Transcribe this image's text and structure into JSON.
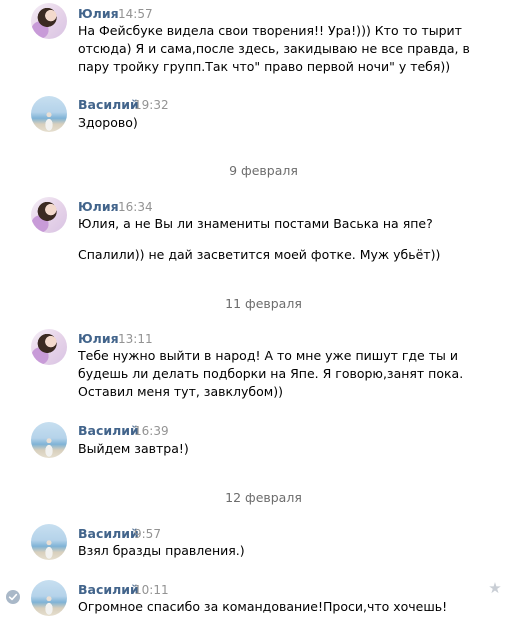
{
  "messages": [
    {
      "author": "Юлия",
      "time": "14:57",
      "lines": [
        "На Фейсбуке видела свои творения!! Ура!))) Кто то тырит",
        "отсюда) Я и сама,после здесь, закидываю не все правда, в",
        "пару тройку групп.Так что\" право первой ночи\" у тебя))"
      ]
    },
    {
      "author": "Василий",
      "time": "19:32",
      "lines": [
        "Здорово)"
      ]
    },
    {
      "date": "9 февраля"
    },
    {
      "author": "Юлия",
      "time": "16:34",
      "lines": [
        "Юлия, а не Вы ли знамениты постами Васька на япе?"
      ],
      "extra": "Спалили)) не дай засветится моей фотке. Муж убьёт))"
    },
    {
      "date": "11 февраля"
    },
    {
      "author": "Юлия",
      "time": "13:11",
      "lines": [
        "Тебе нужно выйти в народ! А то мне уже пишут где ты и",
        "будешь ли делать подборки на Япе. Я говорю,занят пока.",
        "Оставил меня тут, завклубом))"
      ]
    },
    {
      "author": "Василий",
      "time": "16:39",
      "lines": [
        "Выйдем завтра!)"
      ]
    },
    {
      "date": "12 февраля"
    },
    {
      "author": "Василий",
      "time": "9:57",
      "lines": [
        "Взял бразды правления.)"
      ]
    },
    {
      "author": "Василий",
      "time": "10:11",
      "lines": [
        "Огромное спасибо за командование!Проси,что хочешь!"
      ]
    }
  ],
  "icons": {
    "selected_check": "check-circle-icon",
    "favorite_star": "star-icon"
  },
  "colors": {
    "author_link": "#42648b",
    "timestamp": "#939393",
    "date_separator": "#6d6d6d"
  }
}
